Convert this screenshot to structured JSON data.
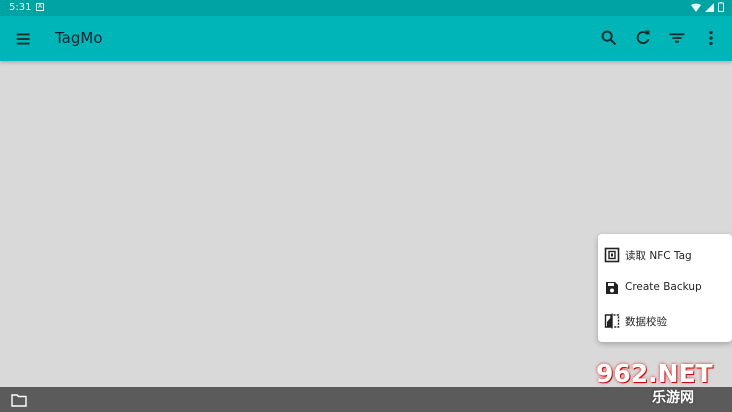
{
  "status_bar": {
    "time": "5:31",
    "notification_glyph": "A"
  },
  "app_bar": {
    "title": "TagMo",
    "icons": [
      "menu-icon",
      "search-icon",
      "refresh-icon",
      "filter-icon",
      "more-vert-icon"
    ]
  },
  "popup_menu": {
    "items": [
      {
        "label": "读取 NFC Tag",
        "icon": "nfc-tag-icon"
      },
      {
        "label": "Create Backup",
        "icon": "save-icon"
      },
      {
        "label": "数据校验",
        "icon": "compare-icon"
      }
    ]
  },
  "bottom_bar": {
    "icon": "folder-icon"
  },
  "watermark": {
    "top": "962.NET",
    "bottom": "乐游网"
  },
  "colors": {
    "status_bar": "#00a3a3",
    "app_bar": "#00b5b8",
    "content_bg": "#d9d9d9",
    "bottom_bar": "#5b5b5b"
  }
}
